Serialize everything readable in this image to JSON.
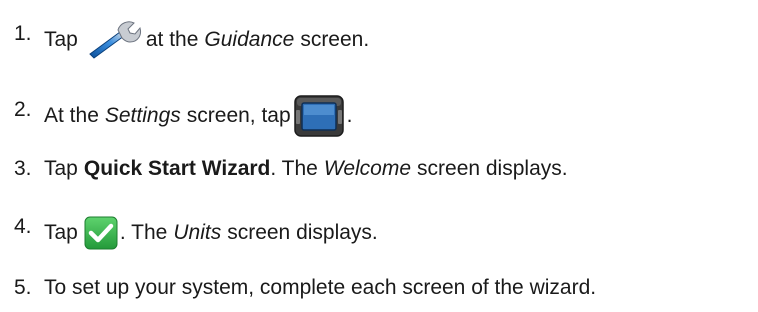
{
  "steps": [
    {
      "number": "1.",
      "tap": "Tap",
      "icon": "wrench-icon",
      "text_after": "at the",
      "screen": "Guidance",
      "text_end": "screen."
    },
    {
      "number": "2.",
      "text_before": "At the",
      "screen": "Settings",
      "text_mid": "screen, tap",
      "icon": "display-console-icon",
      "text_end": "."
    },
    {
      "number": "3.",
      "tap": "Tap",
      "bold": "Quick Start Wizard",
      "text_mid": ". The",
      "screen": "Welcome",
      "text_end": "screen displays."
    },
    {
      "number": "4.",
      "tap": "Tap",
      "icon": "green-checkmark-icon",
      "text_mid": ". The",
      "screen": "Units",
      "text_end": "screen displays."
    },
    {
      "number": "5.",
      "text": "To set up your system, complete each screen of the wizard."
    }
  ],
  "colors": {
    "text": "#1a1a1a",
    "check_green": "#33b24a",
    "wrench_blue": "#1f6fc2",
    "display_blue": "#2e6fb7",
    "display_body": "#3a3a3a"
  }
}
